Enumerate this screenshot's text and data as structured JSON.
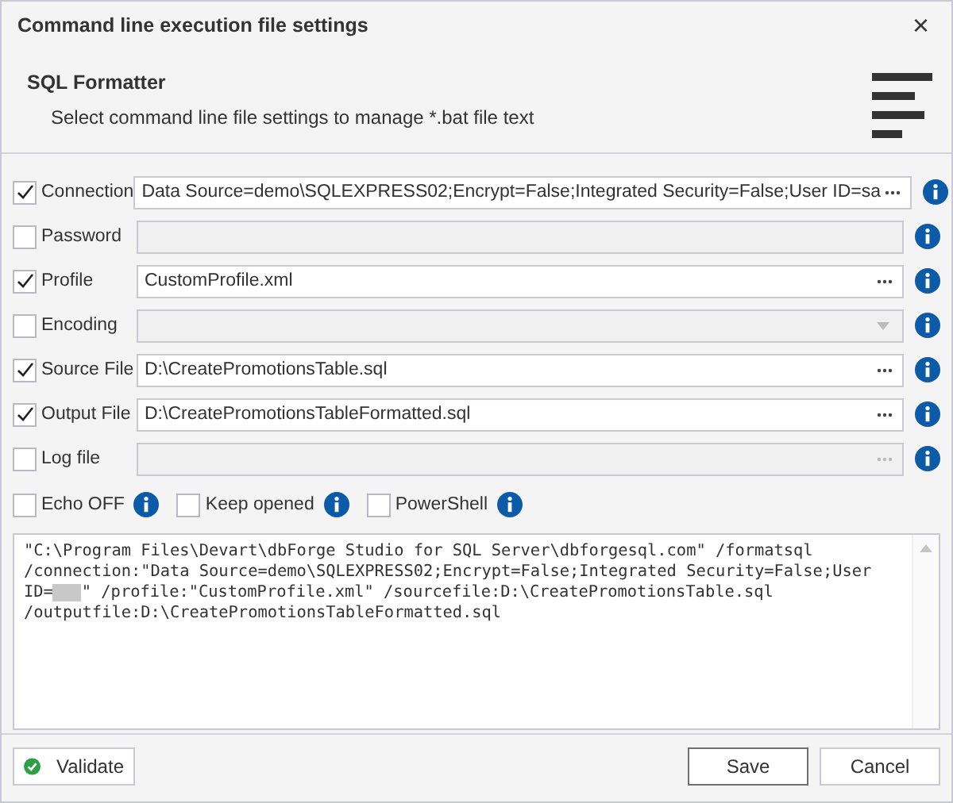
{
  "window": {
    "title": "Command line execution file settings",
    "close": "×"
  },
  "header": {
    "title": "SQL Formatter",
    "subtitle": "Select command line file settings to manage *.bat file text"
  },
  "rows": [
    {
      "label": "Connection",
      "checked": true,
      "value": "Data Source=demo\\SQLEXPRESS02;Encrypt=False;Integrated Security=False;User ID=sa",
      "kind": "browse",
      "disabled": false
    },
    {
      "label": "Password",
      "checked": false,
      "value": "",
      "kind": "plain",
      "disabled": true
    },
    {
      "label": "Profile",
      "checked": true,
      "value": "CustomProfile.xml",
      "kind": "browse",
      "disabled": false
    },
    {
      "label": "Encoding",
      "checked": false,
      "value": "",
      "kind": "dropdown",
      "disabled": true
    },
    {
      "label": "Source File",
      "checked": true,
      "value": "D:\\CreatePromotionsTable.sql",
      "kind": "browse",
      "disabled": false
    },
    {
      "label": "Output File",
      "checked": true,
      "value": "D:\\CreatePromotionsTableFormatted.sql",
      "kind": "browse",
      "disabled": false
    },
    {
      "label": "Log file",
      "checked": false,
      "value": "",
      "kind": "browse",
      "disabled": true
    }
  ],
  "options": [
    {
      "label": "Echo OFF",
      "checked": false
    },
    {
      "label": "Keep opened",
      "checked": false
    },
    {
      "label": "PowerShell",
      "checked": false
    }
  ],
  "command": {
    "before": "\"C:\\Program Files\\Devart\\dbForge Studio for SQL Server\\dbforgesql.com\" /formatsql /connection:\"Data Source=demo\\SQLEXPRESS02;Encrypt=False;Integrated Security=False;User ID=",
    "redacted": true,
    "after": "\" /profile:\"CustomProfile.xml\" /sourcefile:D:\\CreatePromotionsTable.sql /outputfile:D:\\CreatePromotionsTableFormatted.sql"
  },
  "buttons": {
    "validate": "Validate",
    "save": "Save",
    "cancel": "Cancel"
  }
}
